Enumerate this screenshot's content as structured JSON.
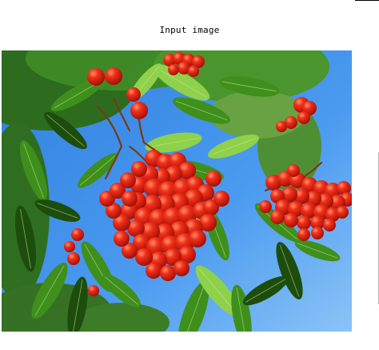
{
  "figure": {
    "title": "Input image"
  },
  "image": {
    "subject": "rowan-berries",
    "colors": {
      "sky": "#3d8ee8",
      "sky_light": "#7fb8f5",
      "berry": "#e8200f",
      "berry_shadow": "#a80d06",
      "berry_highlight": "#ff7a5a",
      "leaf": "#3f8f1c",
      "leaf_light": "#8fd14a",
      "leaf_dark": "#1d4d0c",
      "stem": "#7a3a12"
    }
  }
}
